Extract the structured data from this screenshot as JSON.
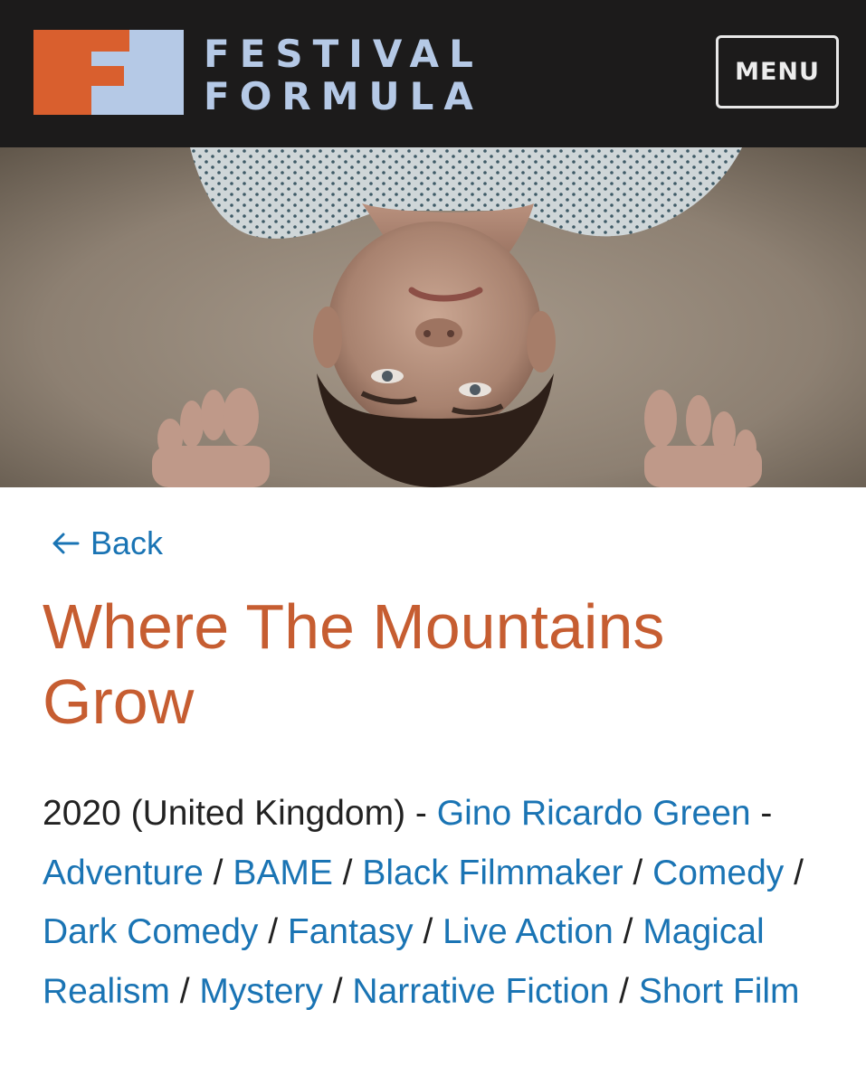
{
  "brand": {
    "name_line1": "FESTIVAL",
    "name_line2": "FORMULA",
    "colors": {
      "orange": "#d95f2e",
      "light_blue": "#b5c9e6",
      "header_bg": "#1c1b1b"
    }
  },
  "header": {
    "menu_label": "MENU"
  },
  "hero": {
    "icon": "film-still-image"
  },
  "nav": {
    "back_label": "Back"
  },
  "film": {
    "title": "Where The Mountains Grow",
    "year_country": "2020 (United Kingdom)",
    "separator": " - ",
    "director": "Gino Ricardo Green",
    "genre_separator": " / ",
    "genres": [
      "Adventure",
      "BAME",
      "Black Filmmaker",
      "Comedy",
      "Dark Comedy",
      "Fantasy",
      "Live Action",
      "Magical Realism",
      "Mystery",
      "Narrative Fiction",
      "Short Film"
    ]
  },
  "colors": {
    "link": "#1a74b4",
    "title": "#c65d31",
    "text": "#222222"
  }
}
